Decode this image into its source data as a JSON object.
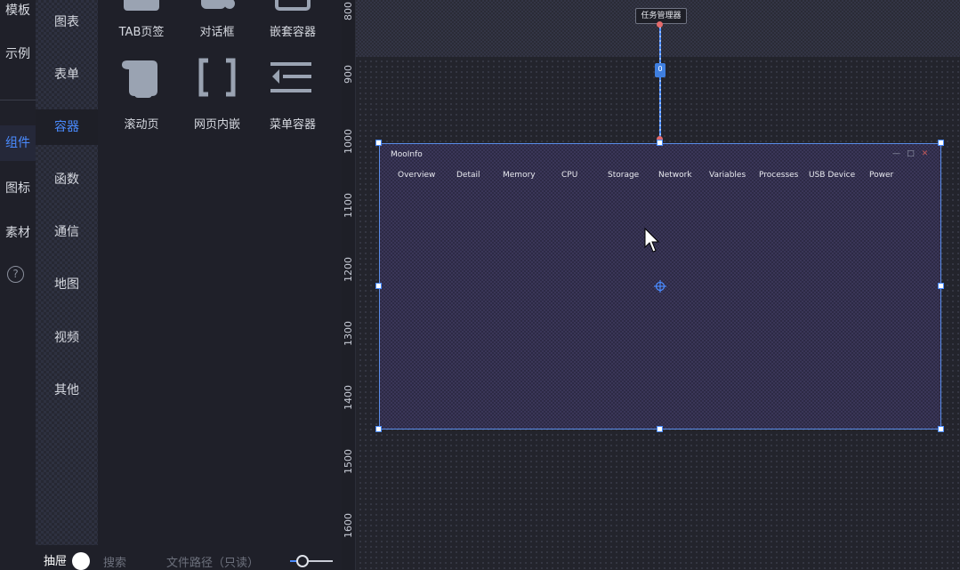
{
  "rail": {
    "items": [
      {
        "label": "模板"
      },
      {
        "label": "示例"
      },
      {
        "label": "组件"
      },
      {
        "label": "图标"
      },
      {
        "label": "素材"
      }
    ],
    "help_glyph": "?"
  },
  "categories": [
    "图表",
    "表单",
    "容器",
    "函数",
    "通信",
    "地图",
    "视频",
    "其他"
  ],
  "components": [
    {
      "label": "TAB页签",
      "icon": "tab-page-icon"
    },
    {
      "label": "对话框",
      "icon": "dialog-icon"
    },
    {
      "label": "嵌套容器",
      "icon": "nested-container-icon"
    },
    {
      "label": "滚动页",
      "icon": "scroll-page-icon"
    },
    {
      "label": "网页内嵌",
      "icon": "iframe-embed-icon"
    },
    {
      "label": "菜单容器",
      "icon": "menu-container-icon"
    }
  ],
  "bottom_bar": {
    "drawer_label": "抽屉",
    "search_label": "搜索",
    "path_label": "文件路径（只读）",
    "zoom_fraction": 0.3
  },
  "ruler": {
    "ticks": [
      "800",
      "900",
      "1000",
      "1100",
      "1200",
      "1300",
      "1400",
      "1500",
      "1600"
    ]
  },
  "canvas": {
    "task_node_label": "任务管理器",
    "connector_badge": "0",
    "window": {
      "title": "MooInfo",
      "tabs": [
        "Overview",
        "Detail",
        "Memory",
        "CPU",
        "Storage",
        "Network",
        "Variables",
        "Processes",
        "USB Device",
        "Power"
      ],
      "controls": [
        "—",
        "□",
        "✕"
      ]
    }
  },
  "colors": {
    "accent": "#4a8bff",
    "background": "#1e1f27",
    "connector_dot": "#e46b6b"
  }
}
